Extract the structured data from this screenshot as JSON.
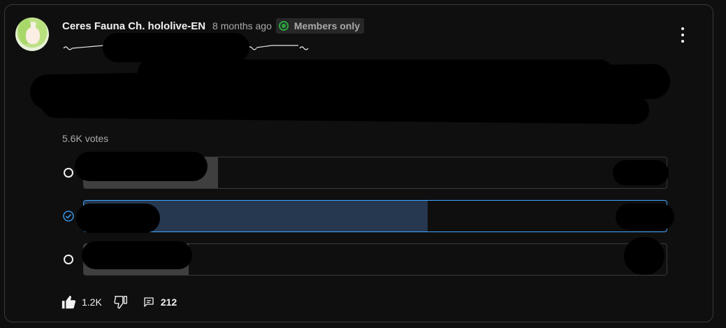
{
  "post": {
    "author": "Ceres Fauna Ch. hololive-EN",
    "time": "8 months ago",
    "badge_label": "Members only",
    "badge_icon": "star-badge-icon",
    "more_icon": "vertical-dots-icon"
  },
  "poll": {
    "votes_label": "5.6K votes",
    "options": [
      {
        "text": "",
        "fill_fraction": 0.23,
        "selected": false
      },
      {
        "text": "",
        "fill_fraction": 0.59,
        "selected": true
      },
      {
        "text": "",
        "fill_fraction": 0.18,
        "selected": false
      }
    ]
  },
  "actions": {
    "like_count": "1.2K",
    "comment_count": "212",
    "like_icon": "thumbs-up-icon",
    "dislike_icon": "thumbs-down-icon",
    "comment_icon": "comment-icon"
  },
  "colors": {
    "background": "#0f0f0f",
    "selected_accent": "#3ea6ff",
    "selected_fill": "#263850",
    "unselected_fill": "#3f3f3f",
    "members_badge_green": "#2ba640"
  }
}
